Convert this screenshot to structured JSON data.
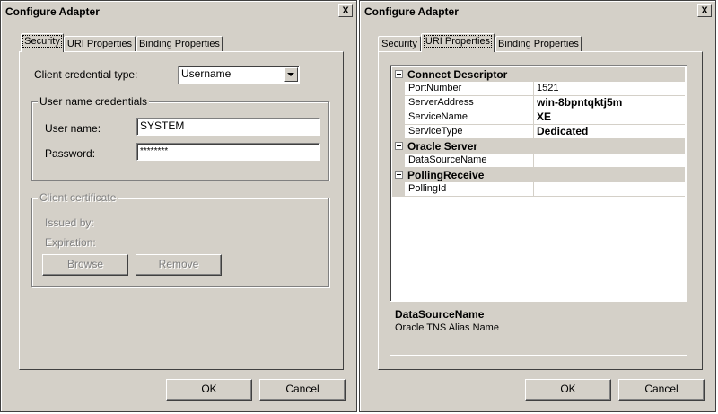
{
  "left_dialog": {
    "title": "Configure Adapter",
    "close_label": "X",
    "tabs": [
      {
        "label": "Security",
        "active": true
      },
      {
        "label": "URI Properties",
        "active": false
      },
      {
        "label": "Binding Properties",
        "active": false
      }
    ],
    "security": {
      "credential_type_label": "Client credential type:",
      "credential_type_value": "Username",
      "user_group_title": "User name credentials",
      "username_label": "User name:",
      "username_value": "SYSTEM",
      "password_label": "Password:",
      "password_value": "********",
      "cert_group_title": "Client certificate",
      "issued_by_label": "Issued by:",
      "expiration_label": "Expiration:",
      "browse_label": "Browse",
      "remove_label": "Remove"
    },
    "ok_label": "OK",
    "cancel_label": "Cancel"
  },
  "right_dialog": {
    "title": "Configure Adapter",
    "close_label": "X",
    "tabs": [
      {
        "label": "Security",
        "active": false
      },
      {
        "label": "URI Properties",
        "active": true
      },
      {
        "label": "Binding Properties",
        "active": false
      }
    ],
    "property_grid": {
      "categories": [
        {
          "name": "Connect Descriptor",
          "properties": [
            {
              "name": "PortNumber",
              "value": "1521",
              "bold": false
            },
            {
              "name": "ServerAddress",
              "value": "win-8bpntqktj5m",
              "bold": true
            },
            {
              "name": "ServiceName",
              "value": "XE",
              "bold": true
            },
            {
              "name": "ServiceType",
              "value": "Dedicated",
              "bold": true
            }
          ]
        },
        {
          "name": "Oracle Server",
          "properties": [
            {
              "name": "DataSourceName",
              "value": "",
              "bold": false
            }
          ]
        },
        {
          "name": "PollingReceive",
          "properties": [
            {
              "name": "PollingId",
              "value": "",
              "bold": false
            }
          ]
        }
      ]
    },
    "description": {
      "title": "DataSourceName",
      "text": "Oracle TNS Alias Name"
    },
    "ok_label": "OK",
    "cancel_label": "Cancel"
  },
  "colors": {
    "dialog_bg": "#d4d0c8",
    "field_bg": "#ffffff",
    "disabled_text": "#808080"
  }
}
